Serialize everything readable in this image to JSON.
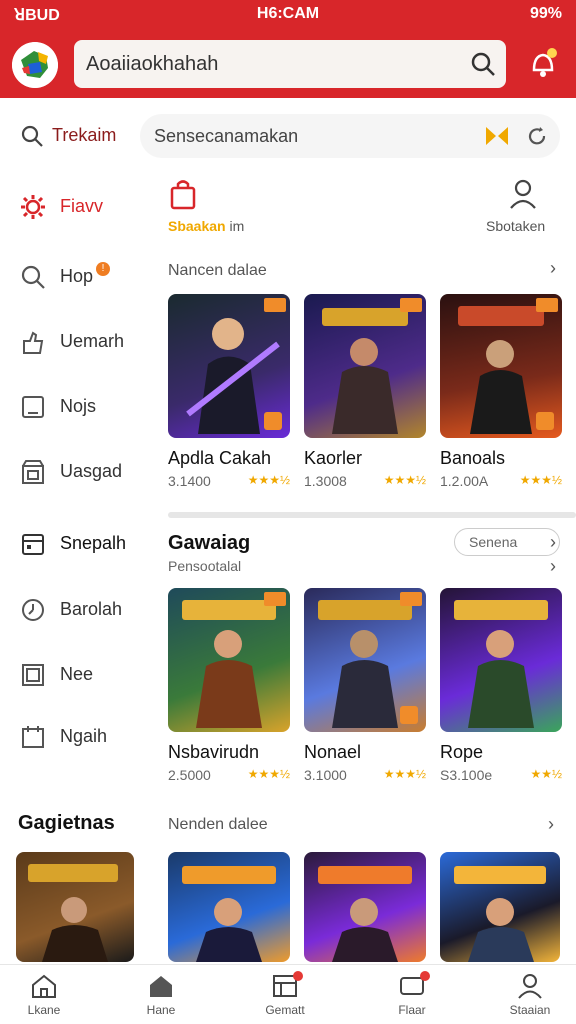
{
  "status": {
    "left": "ꓤBUD",
    "time": "H6:CAM",
    "battery": "99%"
  },
  "header": {
    "search_text": "Aoaiiaokhahah"
  },
  "subbar": {
    "label": "Trekaim",
    "search_text": "Sensecanamakan"
  },
  "sidebar": {
    "items": [
      {
        "label": "Fiavv",
        "icon": "gear-icon",
        "active": true
      },
      {
        "label": "Hop",
        "icon": "search-icon",
        "badge": "!"
      },
      {
        "label": "Uemarh",
        "icon": "hand-icon"
      },
      {
        "label": "Nojs",
        "icon": "tablet-icon"
      },
      {
        "label": "Uasgad",
        "icon": "store-icon"
      },
      {
        "label": "Snepalh",
        "icon": "calendar-icon"
      },
      {
        "label": "Barolah",
        "icon": "clock-icon"
      },
      {
        "label": "Nee",
        "icon": "window-icon"
      },
      {
        "label": "Ngaih",
        "icon": "calendar-icon"
      }
    ]
  },
  "content": {
    "mini_left_label_colored": "Sbaakan",
    "mini_left_label_plain": "im",
    "mini_right_label": "Sbotaken",
    "section1_title": "Nancen dalae",
    "row1": [
      {
        "name": "Apdla Cakah",
        "meta": "3.1400",
        "stars": "★★★½",
        "palette": [
          "#1a2a2f",
          "#6a2bd8",
          "#ee7b2b"
        ]
      },
      {
        "name": "Kaorler",
        "meta": "1.3008",
        "stars": "★★★½",
        "palette": [
          "#1a1a4f",
          "#b2862b",
          "#4e2b8a"
        ]
      },
      {
        "name": "Banoals",
        "meta": "1.2.00A",
        "stars": "★★★½",
        "palette": [
          "#2a1010",
          "#e55a1f",
          "#f3b53a"
        ]
      }
    ],
    "section2_title": "Gawaiag",
    "section2_sub": "Pensootalal",
    "section2_button": "Senena",
    "row2": [
      {
        "name": "Nsbavirudn",
        "meta": "2.5000",
        "stars": "★★★½",
        "palette": [
          "#1f4a5a",
          "#d9a32b",
          "#3a7a3a"
        ]
      },
      {
        "name": "Nonael",
        "meta": "3.1000",
        "stars": "★★★½",
        "palette": [
          "#2a2a5a",
          "#5a7adf",
          "#c97d2f"
        ]
      },
      {
        "name": "Rope",
        "meta": "S3.100e",
        "stars": "★★½",
        "palette": [
          "#241436",
          "#6a2bd8",
          "#3aa65a"
        ]
      }
    ],
    "section3_title": "Nenden dalee",
    "row3": [
      {
        "palette": [
          "#5a3a1a",
          "#d8a32b",
          "#1a1a1a"
        ]
      },
      {
        "palette": [
          "#1a3a6a",
          "#ef9b2b",
          "#2a6ad8"
        ]
      },
      {
        "palette": [
          "#2a1a3a",
          "#ef7b2b",
          "#7a2bd8"
        ]
      },
      {
        "palette": [
          "#2b6ad8",
          "#f3b53a",
          "#1a1a2a"
        ]
      }
    ]
  },
  "left_section3_title": "Gagietnas",
  "bottomnav": {
    "items": [
      {
        "label": "Lkane",
        "icon": "home-icon"
      },
      {
        "label": "Hane",
        "icon": "house-icon"
      },
      {
        "label": "Gematt",
        "icon": "grid-icon",
        "badge": true
      },
      {
        "label": "Flaar",
        "icon": "chat-icon",
        "badge": true
      },
      {
        "label": "Staaian",
        "icon": "user-icon"
      }
    ]
  }
}
